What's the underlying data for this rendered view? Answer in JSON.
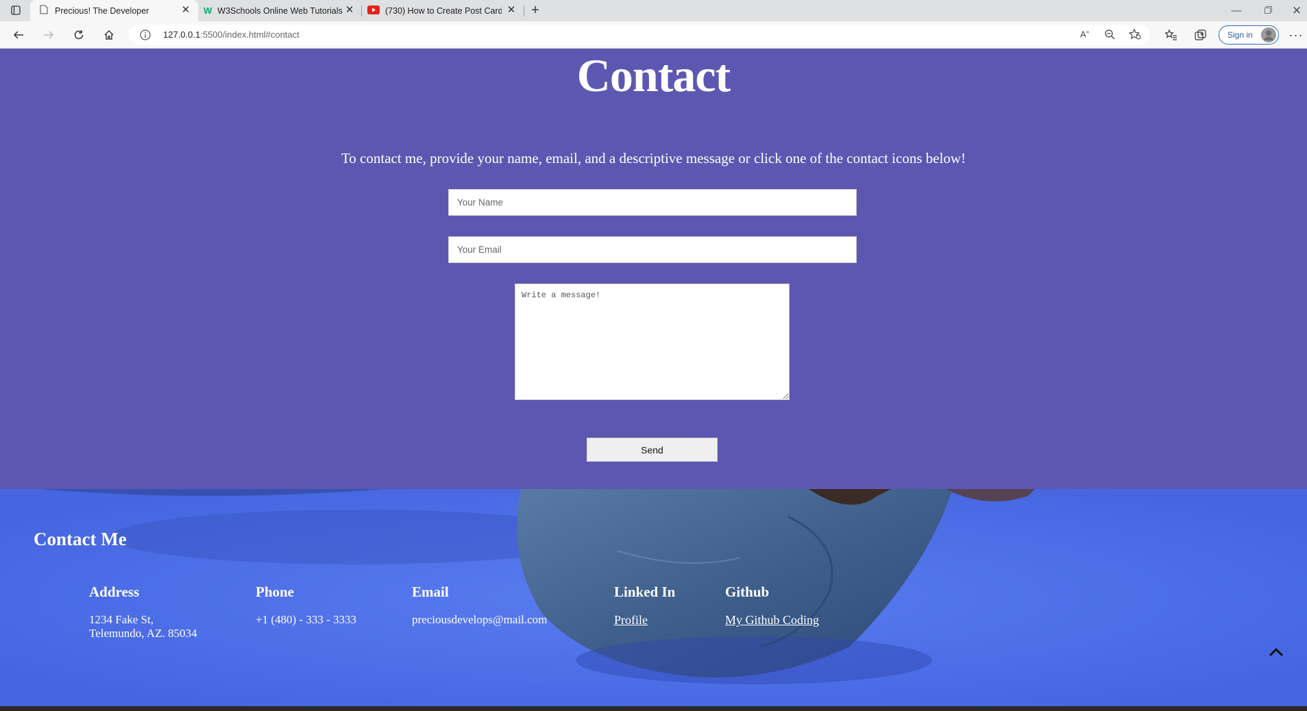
{
  "browser": {
    "tabs": [
      {
        "title": "Precious! The Developer",
        "icon": "page-icon",
        "active": true
      },
      {
        "title": "W3Schools Online Web Tutorials",
        "icon": "w3schools-icon",
        "active": false
      },
      {
        "title": "(730) How to Create Post Cards |",
        "icon": "youtube-icon",
        "active": false
      }
    ],
    "url_host": "127.0.0.1",
    "url_path": ":5500/index.html#contact",
    "signin_label": "Sign in"
  },
  "contact": {
    "title": "Contact",
    "intro": "To contact me, provide your name, email, and a descriptive message or click one of the contact icons below!",
    "name_placeholder": "Your Name",
    "email_placeholder": "Your Email",
    "message_placeholder": "Write a message!",
    "send_label": "Send"
  },
  "footer": {
    "heading": "Contact Me",
    "address": {
      "title": "Address",
      "line1": "1234 Fake St,",
      "line2": "Telemundo, AZ. 85034"
    },
    "phone": {
      "title": "Phone",
      "value": "+1 (480) - 333 - 3333"
    },
    "email": {
      "title": "Email",
      "value": "preciousdevelops@mail.com"
    },
    "linkedin": {
      "title": "Linked In",
      "link": "Profile"
    },
    "github": {
      "title": "Github",
      "link": "My Github Coding"
    }
  },
  "colors": {
    "contact_bg": "#5c58b2",
    "footer_bg": "#4c6fe6",
    "text": "#ffffff"
  }
}
